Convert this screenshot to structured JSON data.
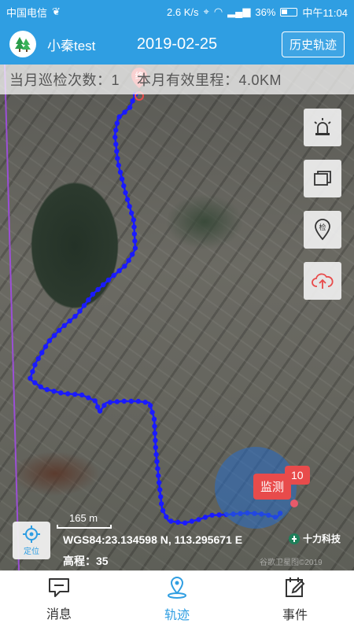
{
  "status_bar": {
    "carrier": "中国电信",
    "speed": "2.6 K/s",
    "signal": "4G",
    "battery": "36%",
    "time": "中午11:04"
  },
  "header": {
    "user": "小秦test",
    "date": "2019-02-25",
    "history_button": "历史轨迹"
  },
  "stats": {
    "monthly_patrols": "当月巡检次数：1",
    "monthly_distance": "本月有效里程：4.0KM"
  },
  "map": {
    "end_marker": "终",
    "scale_label": "165 m",
    "coordinates": "WGS84:23.134598 N, 113.295671 E",
    "altitude": "高程：35",
    "brand": "十力科技",
    "credit": "谷歌卫星图©2019",
    "monitor_label": "监测",
    "monitor_count": "10",
    "locate_label": "定位",
    "track_color": "#1a1aff"
  },
  "map_buttons": [
    {
      "icon": "alarm-light-icon"
    },
    {
      "icon": "layers-icon"
    },
    {
      "icon": "inspection-pin-icon",
      "text": "检"
    },
    {
      "icon": "cloud-upload-icon"
    }
  ],
  "nav": {
    "messages": "消息",
    "track": "轨迹",
    "events": "事件"
  }
}
